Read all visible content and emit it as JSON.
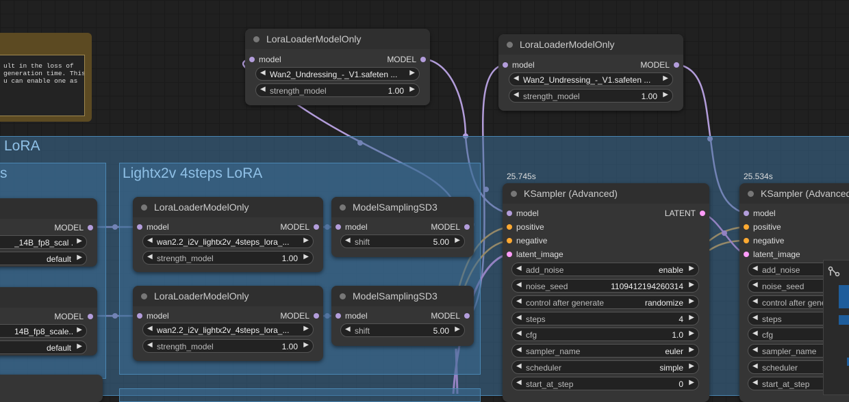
{
  "note": {
    "lines": [
      "ult in the loss of",
      "generation time. This",
      "u can enable one as"
    ]
  },
  "groups": {
    "main_title": "LoRA",
    "left_title": "s",
    "lightx_title": "Lightx2v 4steps LoRA",
    "bottom_title": ""
  },
  "labels": {
    "model": "model",
    "MODEL": "MODEL",
    "LATENT": "LATENT",
    "positive": "positive",
    "negative": "negative",
    "latent_image": "latent_image",
    "strength_model": "strength_model",
    "shift": "shift"
  },
  "lora_top1": {
    "title": "LoraLoaderModelOnly",
    "lora_name": "Wan2_Undressing_-_V1.safeten ...",
    "strength": "1.00"
  },
  "lora_top2": {
    "title": "LoraLoaderModelOnly",
    "lora_name": "Wan2_Undressing_-_V1.safeten ...",
    "strength": "1.00"
  },
  "left_node1": {
    "name": "_14B_fp8_scal ...",
    "value": "default"
  },
  "left_node2": {
    "name": "14B_fp8_scale...",
    "value": "default"
  },
  "lora_mid1": {
    "title": "LoraLoaderModelOnly",
    "lora_name": "wan2.2_i2v_lightx2v_4steps_lora_...",
    "strength": "1.00"
  },
  "lora_mid2": {
    "title": "LoraLoaderModelOnly",
    "lora_name": "wan2.2_i2v_lightx2v_4steps_lora_...",
    "strength": "1.00"
  },
  "msd1": {
    "title": "ModelSamplingSD3",
    "shift": "5.00"
  },
  "msd2": {
    "title": "ModelSamplingSD3",
    "shift": "5.00"
  },
  "ksampler1": {
    "timing": "25.745s",
    "title": "KSampler (Advanced)",
    "widgets": [
      {
        "label": "add_noise",
        "value": "enable"
      },
      {
        "label": "noise_seed",
        "value": "1109412194260314"
      },
      {
        "label": "control after generate",
        "value": "randomize"
      },
      {
        "label": "steps",
        "value": "4"
      },
      {
        "label": "cfg",
        "value": "1.0"
      },
      {
        "label": "sampler_name",
        "value": "euler"
      },
      {
        "label": "scheduler",
        "value": "simple"
      },
      {
        "label": "start_at_step",
        "value": "0"
      }
    ]
  },
  "ksampler2": {
    "timing": "25.534s",
    "title": "KSampler (Advanced)",
    "widgets": [
      {
        "label": "add_noise"
      },
      {
        "label": "noise_seed"
      },
      {
        "label": "control after gene"
      },
      {
        "label": "steps"
      },
      {
        "label": "cfg"
      },
      {
        "label": "sampler_name"
      },
      {
        "label": "scheduler"
      },
      {
        "label": "start_at_step"
      }
    ]
  },
  "colors": {
    "model_wire": "#b39ddb",
    "conditioning_wire": "#ffa931",
    "latent_wire": "#ff9cf9",
    "group_fill": "#3c6e96",
    "note_frame": "#5c4a22"
  }
}
